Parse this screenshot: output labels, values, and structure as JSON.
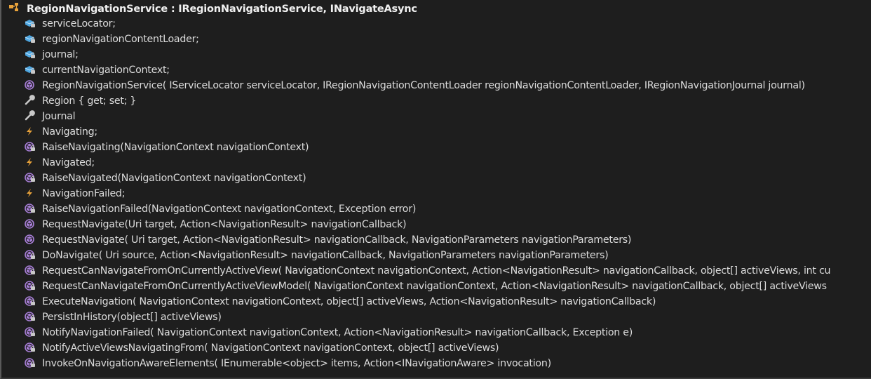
{
  "header": {
    "title": "RegionNavigationService : IRegionNavigationService, INavigateAsync",
    "icon": "class-icon"
  },
  "colors": {
    "background": "#1e1e1e",
    "text": "#dcdcdc",
    "field": "#4ea6e0",
    "method": "#a77ed6",
    "event": "#e8a23a",
    "property": "#c8c8c8"
  },
  "members": [
    {
      "kind": "field",
      "private": true,
      "text": "serviceLocator;"
    },
    {
      "kind": "field",
      "private": true,
      "text": "regionNavigationContentLoader;"
    },
    {
      "kind": "field",
      "private": true,
      "text": "journal;"
    },
    {
      "kind": "field",
      "private": true,
      "text": "currentNavigationContext;"
    },
    {
      "kind": "method",
      "private": false,
      "text": "RegionNavigationService( IServiceLocator serviceLocator, IRegionNavigationContentLoader regionNavigationContentLoader, IRegionNavigationJournal journal)"
    },
    {
      "kind": "property",
      "private": false,
      "text": "Region { get; set; }"
    },
    {
      "kind": "property",
      "private": false,
      "text": "Journal"
    },
    {
      "kind": "event",
      "private": false,
      "text": "Navigating;"
    },
    {
      "kind": "method",
      "private": true,
      "text": "RaiseNavigating(NavigationContext navigationContext)"
    },
    {
      "kind": "event",
      "private": false,
      "text": "Navigated;"
    },
    {
      "kind": "method",
      "private": true,
      "text": "RaiseNavigated(NavigationContext navigationContext)"
    },
    {
      "kind": "event",
      "private": false,
      "text": "NavigationFailed;"
    },
    {
      "kind": "method",
      "private": true,
      "text": "RaiseNavigationFailed(NavigationContext navigationContext, Exception error)"
    },
    {
      "kind": "method",
      "private": false,
      "text": "RequestNavigate(Uri target, Action<NavigationResult> navigationCallback)"
    },
    {
      "kind": "method",
      "private": false,
      "text": "RequestNavigate( Uri target, Action<NavigationResult> navigationCallback, NavigationParameters navigationParameters)"
    },
    {
      "kind": "method",
      "private": true,
      "text": "DoNavigate( Uri source, Action<NavigationResult> navigationCallback, NavigationParameters navigationParameters)"
    },
    {
      "kind": "method",
      "private": true,
      "text": "RequestCanNavigateFromOnCurrentlyActiveView( NavigationContext navigationContext, Action<NavigationResult> navigationCallback, object[] activeViews, int cu"
    },
    {
      "kind": "method",
      "private": true,
      "text": "RequestCanNavigateFromOnCurrentlyActiveViewModel( NavigationContext navigationContext, Action<NavigationResult> navigationCallback, object[] activeViews"
    },
    {
      "kind": "method",
      "private": true,
      "text": "ExecuteNavigation( NavigationContext navigationContext, object[] activeViews, Action<NavigationResult> navigationCallback)"
    },
    {
      "kind": "method",
      "private": true,
      "text": "PersistInHistory(object[] activeViews)"
    },
    {
      "kind": "method",
      "private": true,
      "text": "NotifyNavigationFailed( NavigationContext navigationContext, Action<NavigationResult> navigationCallback, Exception e)"
    },
    {
      "kind": "method",
      "private": true,
      "text": "NotifyActiveViewsNavigatingFrom( NavigationContext navigationContext, object[] activeViews)"
    },
    {
      "kind": "method",
      "private": true,
      "text": "InvokeOnNavigationAwareElements( IEnumerable<object> items, Action<INavigationAware> invocation)"
    }
  ]
}
